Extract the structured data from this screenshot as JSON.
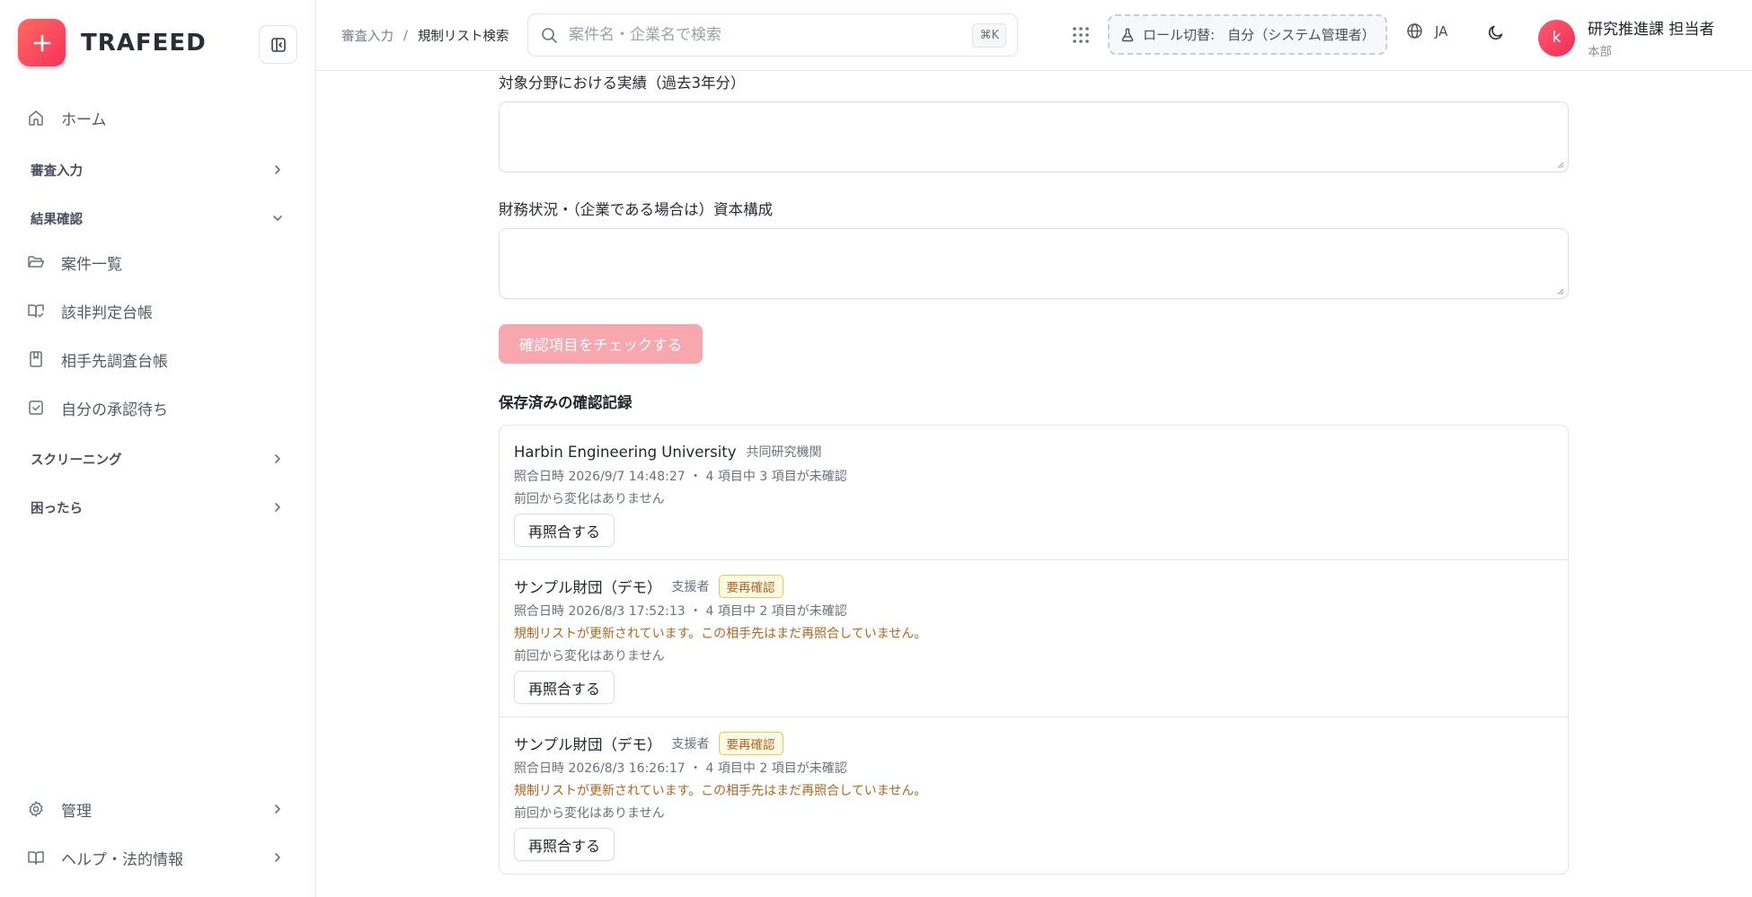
{
  "brand": {
    "name": "TRAFEED",
    "accent": "#f6325c"
  },
  "sidebar": {
    "home": "ホーム",
    "sections": [
      {
        "label": "審査入力"
      },
      {
        "label": "結果確認"
      },
      {
        "label": "スクリーニング"
      },
      {
        "label": "困ったら"
      }
    ],
    "items": [
      {
        "label": "案件一覧",
        "icon": "folder-open-icon"
      },
      {
        "label": "該非判定台帳",
        "icon": "book-check-icon"
      },
      {
        "label": "相手先調査台帳",
        "icon": "notebook-icon"
      },
      {
        "label": "自分の承認待ち",
        "icon": "checkbox-icon"
      }
    ],
    "bottom": [
      {
        "label": "管理",
        "icon": "gear-icon"
      },
      {
        "label": "ヘルプ・法的情報",
        "icon": "book-open-icon"
      }
    ]
  },
  "header": {
    "breadcrumb": {
      "parent": "審査入力",
      "sep": "/",
      "current": "規制リスト検索"
    },
    "search": {
      "placeholder": "案件名・企業名で検索",
      "value": "",
      "shortcut": "⌘K"
    },
    "role": {
      "label": "ロール切替:",
      "value": "自分（システム管理者）"
    },
    "lang": "JA",
    "user": {
      "initial": "k",
      "name": "研究推進課 担当者",
      "dept": "本部"
    }
  },
  "main": {
    "field1_label": "対象分野における実績（過去3年分）",
    "field2_label": "財務状況・（企業である場合は）資本構成",
    "check_button": "確認項目をチェックする",
    "records_title": "保存済みの確認記録",
    "records": [
      {
        "name": "Harbin Engineering University",
        "role": "共同研究機関",
        "badge": "",
        "meta": "照合日時 2026/9/7 14:48:27 ・ 4 項目中 3 項目が未確認",
        "warning": "",
        "nochange": "前回から変化はありません",
        "button": "再照合する"
      },
      {
        "name": "サンプル財団（デモ）",
        "role": "支援者",
        "badge": "要再確認",
        "meta": "照合日時 2026/8/3 17:52:13 ・ 4 項目中 2 項目が未確認",
        "warning": "規制リストが更新されています。この相手先はまだ再照合していません。",
        "nochange": "前回から変化はありません",
        "button": "再照合する"
      },
      {
        "name": "サンプル財団（デモ）",
        "role": "支援者",
        "badge": "要再確認",
        "meta": "照合日時 2026/8/3 16:26:17 ・ 4 項目中 2 項目が未確認",
        "warning": "規制リストが更新されています。この相手先はまだ再照合していません。",
        "nochange": "前回から変化はありません",
        "button": "再照合する"
      }
    ]
  }
}
